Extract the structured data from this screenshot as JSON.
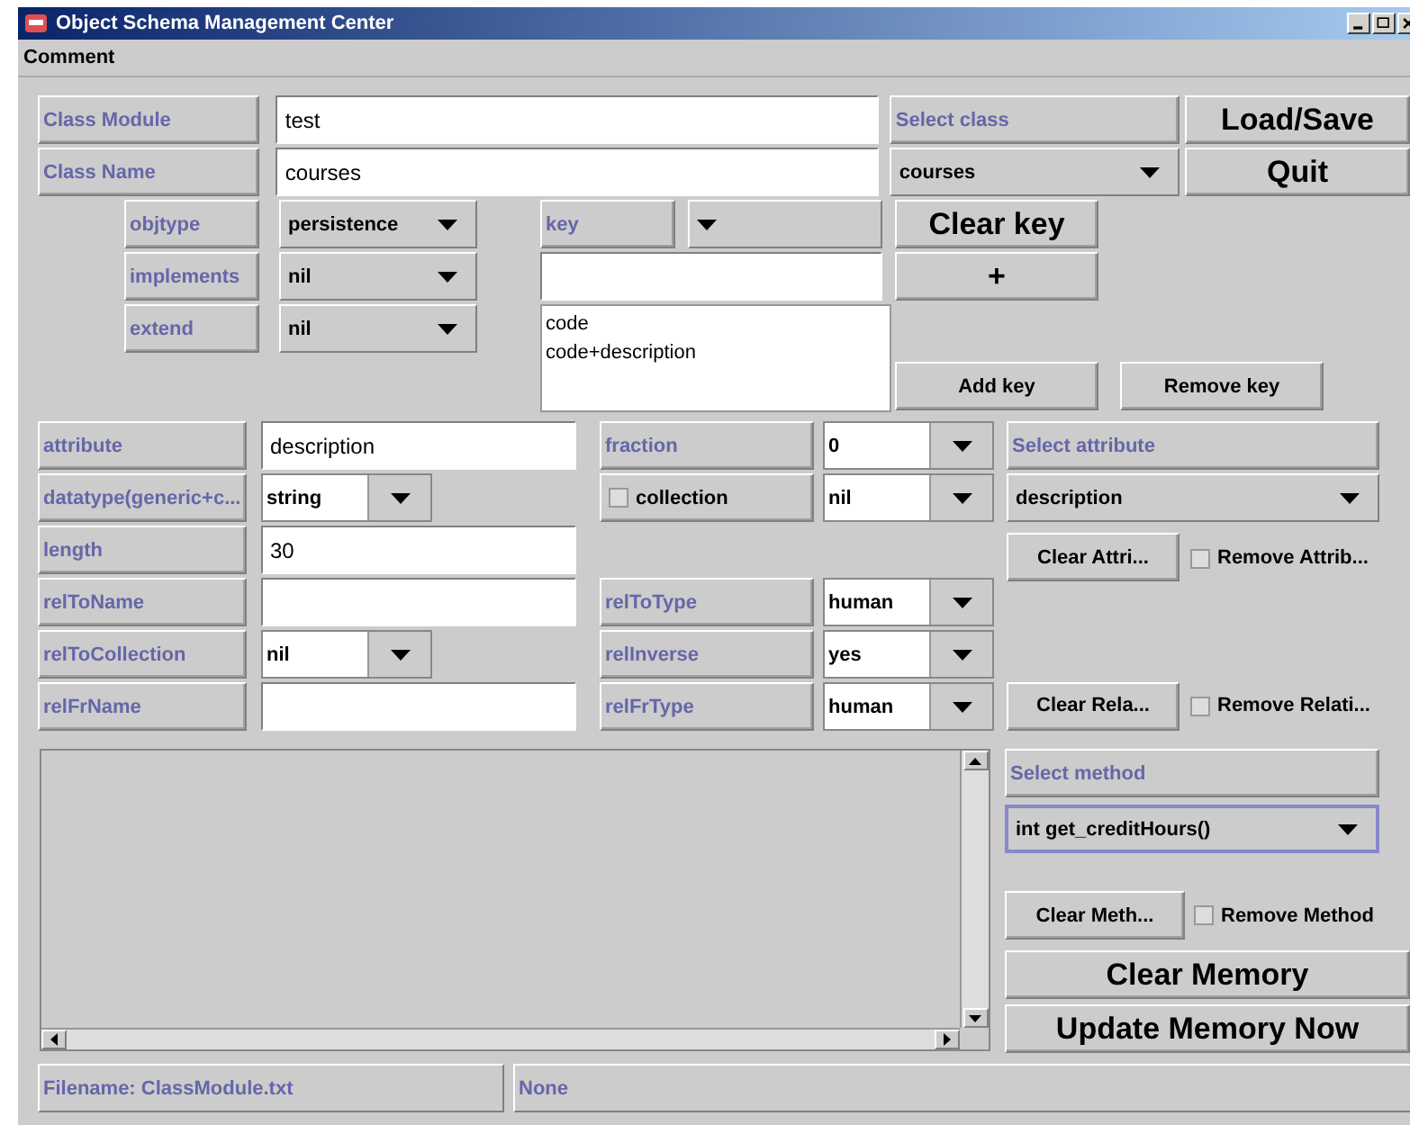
{
  "window": {
    "title": "Object Schema Management Center"
  },
  "menu": [
    "Comment"
  ],
  "class_panel": {
    "class_module": {
      "label": "Class Module",
      "value": "test"
    },
    "class_name": {
      "label": "Class Name",
      "value": "courses"
    },
    "select_class": {
      "label": "Select class",
      "value": "courses"
    },
    "load_save": "Load/Save",
    "quit": "Quit",
    "objtype": {
      "label": "objtype",
      "value": "persistence"
    },
    "implements": {
      "label": "implements",
      "value": "nil"
    },
    "extend": {
      "label": "extend",
      "value": "nil"
    },
    "key": {
      "label": "key"
    },
    "keys": [
      "code",
      "code+description"
    ],
    "clear_key": "Clear key",
    "add": "+",
    "add_key": "Add key",
    "remove_key": "Remove key"
  },
  "attribute_panel": {
    "left": [
      {
        "label": "attribute",
        "kind": "field",
        "value": "description"
      },
      {
        "label": "datatype(generic+c...",
        "kind": "combo",
        "value": "string"
      },
      {
        "label": "length",
        "kind": "field",
        "value": "30"
      },
      {
        "label": "relToName",
        "kind": "field"
      },
      {
        "label": "relToCollection",
        "kind": "combo",
        "value": "nil"
      },
      {
        "label": "relFrName",
        "kind": "field"
      }
    ],
    "middle": [
      {
        "label": "fraction",
        "kind": "button",
        "value": "0"
      },
      {
        "label": "collection",
        "kind": "checkbox",
        "checked": false,
        "value": "nil"
      },
      {
        "label": "relToType",
        "kind": "button",
        "value": "human"
      },
      {
        "label": "relInverse",
        "kind": "button",
        "value": "yes"
      },
      {
        "label": "relFrType",
        "kind": "button",
        "value": "human"
      }
    ],
    "select_attribute": {
      "label": "Select attribute",
      "value": "description"
    },
    "clear_attribute": "Clear Attri...",
    "remove_attribute": {
      "label": "Remove Attrib...",
      "checked": false
    },
    "clear_relation": "Clear Rela...",
    "remove_relation": {
      "label": "Remove Relati...",
      "checked": false
    }
  },
  "method_panel": {
    "select_method": {
      "label": "Select method",
      "value": "int get_creditHours()"
    },
    "clear_method": "Clear Meth...",
    "remove_method": {
      "label": "Remove Method",
      "checked": false
    },
    "clear_memory": "Clear Memory",
    "update_memory": "Update Memory Now"
  },
  "status_bar": [
    "Filename: ClassModule.txt",
    "None"
  ]
}
